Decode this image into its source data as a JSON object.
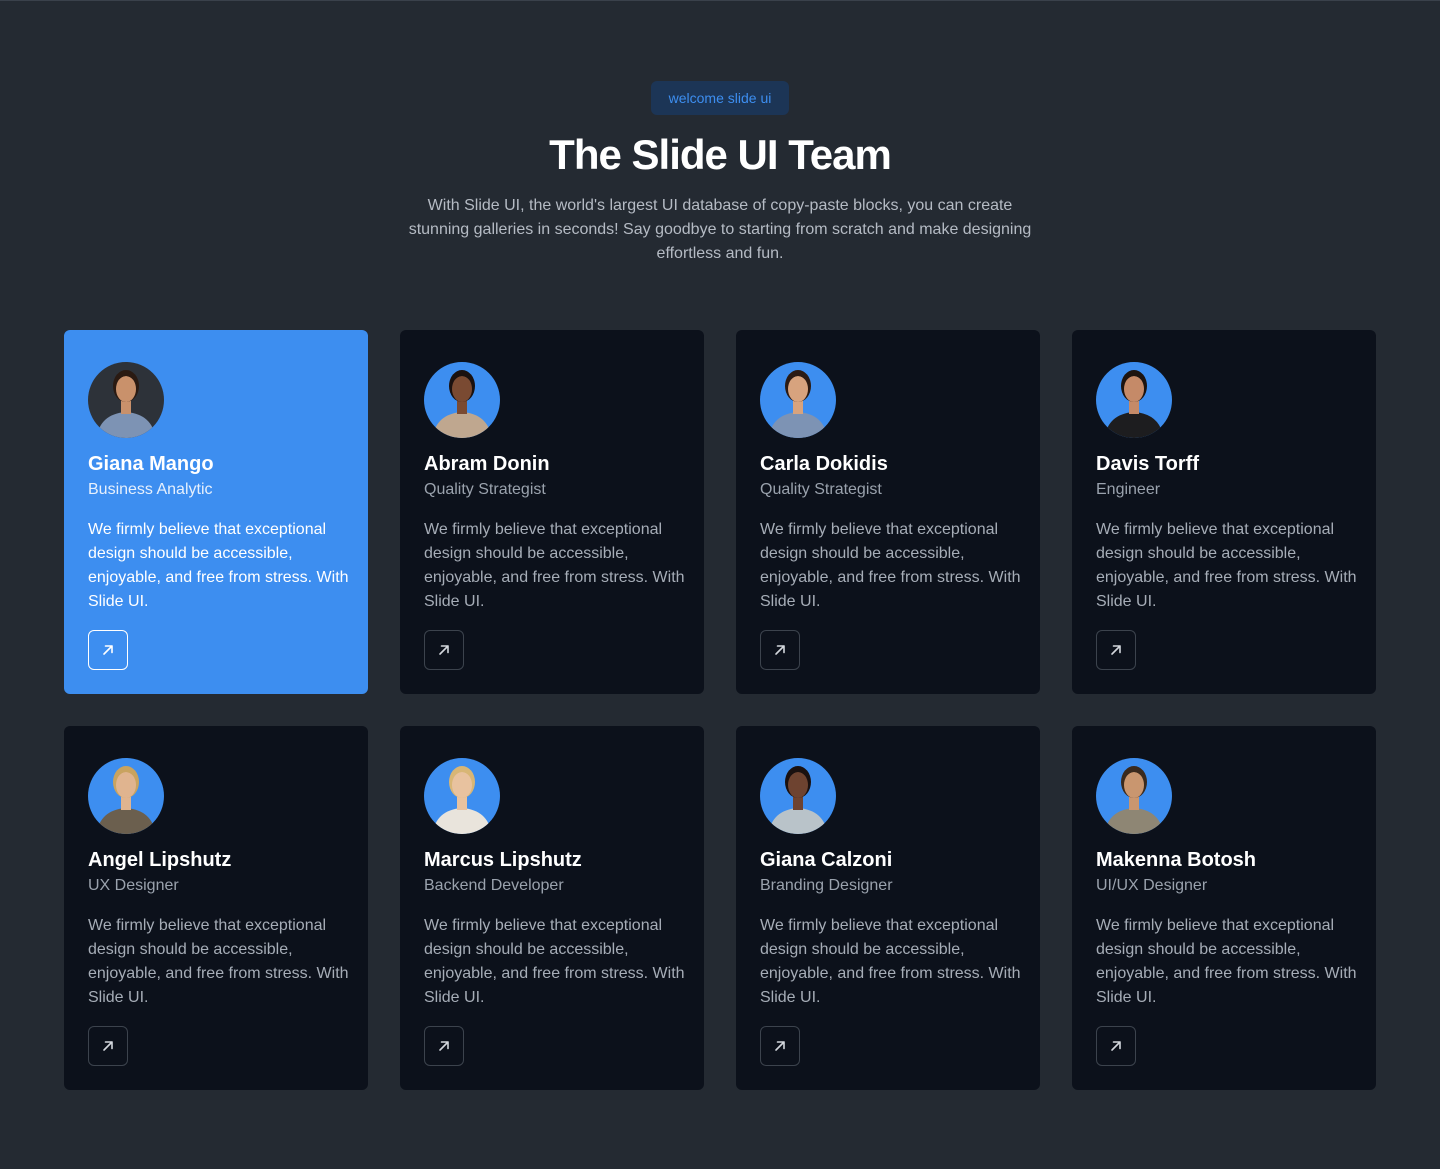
{
  "header": {
    "badge": "welcome slide ui",
    "title": "The Slide UI Team",
    "subtitle": "With Slide UI, the world's largest UI database of copy-paste blocks, you can create stunning galleries in seconds! Say goodbye to starting from scratch and make designing effortless and fun."
  },
  "colors": {
    "background": "#242a32",
    "card": "#0c111b",
    "accent": "#3d8ef0",
    "badge_bg": "#1c3556"
  },
  "team": [
    {
      "name": "Giana Mango",
      "role": "Business Analytic",
      "description": "We firmly believe that exceptional design should be accessible, enjoyable, and free from stress. With Slide UI.",
      "active": true,
      "icon": "arrow-up-right-icon"
    },
    {
      "name": "Abram Donin",
      "role": "Quality Strategist",
      "description": "We firmly believe that exceptional design should be accessible, enjoyable, and free from stress. With Slide UI.",
      "active": false,
      "icon": "arrow-up-right-icon"
    },
    {
      "name": "Carla Dokidis",
      "role": "Quality Strategist",
      "description": "We firmly believe that exceptional design should be accessible, enjoyable, and free from stress. With Slide UI.",
      "active": false,
      "icon": "arrow-up-right-icon"
    },
    {
      "name": "Davis Torff",
      "role": "Engineer",
      "description": "We firmly believe that exceptional design should be accessible, enjoyable, and free from stress. With Slide UI.",
      "active": false,
      "icon": "arrow-up-right-icon"
    },
    {
      "name": "Angel Lipshutz",
      "role": "UX Designer",
      "description": "We firmly believe that exceptional design should be accessible, enjoyable, and free from stress. With Slide UI.",
      "active": false,
      "icon": "arrow-up-right-icon"
    },
    {
      "name": "Marcus Lipshutz",
      "role": "Backend Developer",
      "description": "We firmly believe that exceptional design should be accessible, enjoyable, and free from stress. With Slide UI.",
      "active": false,
      "icon": "arrow-up-right-icon"
    },
    {
      "name": "Giana Calzoni",
      "role": "Branding Designer",
      "description": "We firmly believe that exceptional design should be accessible, enjoyable, and free from stress. With Slide UI.",
      "active": false,
      "icon": "arrow-up-right-icon"
    },
    {
      "name": "Makenna Botosh",
      "role": "UI/UX Designer",
      "description": "We firmly believe that exceptional design should be accessible, enjoyable, and free from stress. With Slide UI.",
      "active": false,
      "icon": "arrow-up-right-icon"
    }
  ]
}
